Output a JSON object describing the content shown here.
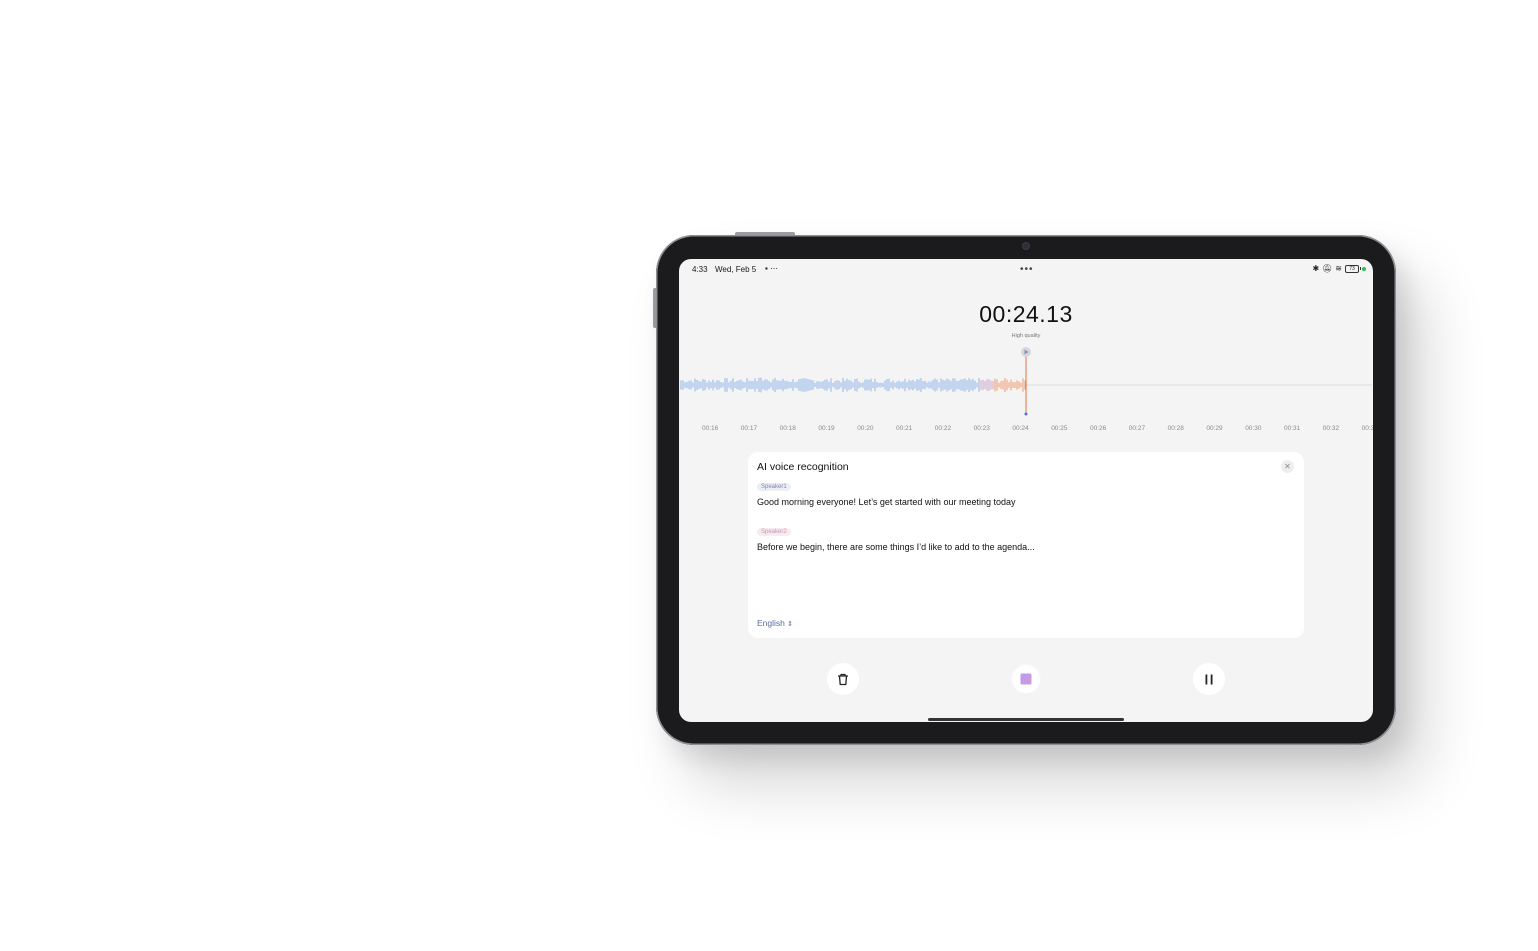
{
  "status_bar": {
    "time": "4:33",
    "date": "Wed, Feb 5",
    "battery": "73"
  },
  "recorder": {
    "elapsed": "00:24.13",
    "quality": "High quality",
    "timeline_ticks": [
      "00:16",
      "00:17",
      "00:18",
      "00:19",
      "00:20",
      "00:21",
      "00:22",
      "00:23",
      "00:24",
      "00:25",
      "00:26",
      "00:27",
      "00:28",
      "00:29",
      "00:30",
      "00:31",
      "00:32",
      "00:3"
    ]
  },
  "ai_panel": {
    "title": "AI voice recognition",
    "close_icon": "close-icon",
    "entries": [
      {
        "speaker": "Speaker1",
        "text": "Good morning everyone! Let’s get started with our meeting today"
      },
      {
        "speaker": "Speaker2",
        "text": "Before we begin, there are some things I’d like to add to the agenda..."
      }
    ],
    "language": "English"
  },
  "controls": {
    "delete_icon": "trash-icon",
    "stop_icon": "stop-icon",
    "pause_icon": "pause-icon"
  },
  "colors": {
    "wave_recorded": "#8fb3e6",
    "wave_recent": "#f0986a",
    "playhead": "#e8743e",
    "speaker2_tag": "#c596ad"
  }
}
